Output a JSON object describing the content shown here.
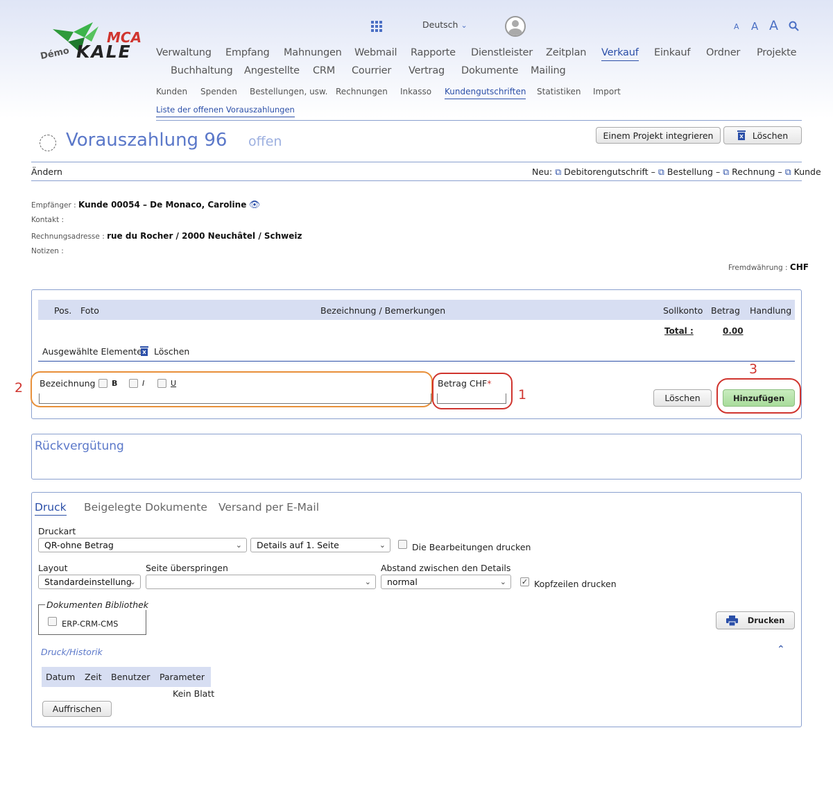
{
  "header": {
    "logo_top": "MCA",
    "logo_demo": "Démo",
    "logo_main": "KALE",
    "language": "Deutsch",
    "font_small": "A",
    "font_medium": "A",
    "font_large": "A"
  },
  "nav": {
    "main": [
      "Verwaltung",
      "Empfang",
      "Mahnungen",
      "Webmail",
      "Rapporte",
      "Dienstleister",
      "Zeitplan",
      "Verkauf",
      "Einkauf",
      "Ordner",
      "Projekte",
      "Buchhaltung",
      "Angestellte",
      "CRM",
      "Courrier",
      "Vertrag",
      "Dokumente",
      "Mailing"
    ],
    "sub": [
      "Kunden",
      "Spenden",
      "Bestellungen, usw.",
      "Rechnungen",
      "Inkasso",
      "Kundengutschriften",
      "Statistiken",
      "Import"
    ],
    "sub2": "Liste der offenen Vorauszahlungen"
  },
  "page": {
    "title": "Vorauszahlung 96",
    "status": "offen",
    "btn_integrate": "Einem Projekt integrieren",
    "btn_delete": "Löschen",
    "edit": "Ändern",
    "new_label": "Neu:",
    "new_links": [
      "Debitorengutschrift",
      "Bestellung",
      "Rechnung",
      "Kunde"
    ],
    "sep": "–"
  },
  "info": {
    "recipient_label": "Empfänger :",
    "recipient_value": "Kunde 00054 – De Monaco, Caroline",
    "contact_label": "Kontakt :",
    "address_label": "Rechnungsadresse :",
    "address_value": "rue du Rocher / 2000 Neuchâtel / Schweiz",
    "notes_label": "Notizen :",
    "currency_label": "Fremdwährung :",
    "currency_value": "CHF"
  },
  "table": {
    "headers": [
      "Pos.",
      "Foto",
      "Bezeichnung / Bemerkungen",
      "Sollkonto",
      "Betrag",
      "Handlung"
    ],
    "total_label": "Total :",
    "total_value": "0.00",
    "selected_label": "Ausgewählte Elemente:",
    "selected_delete": "Löschen"
  },
  "form": {
    "desc_label": "Bezeichnung",
    "bold": "B",
    "italic": "I",
    "underline": "U",
    "amount_label": "Betrag CHF",
    "required": "*",
    "btn_clear": "Löschen",
    "btn_add": "Hinzufügen",
    "annot": [
      "1",
      "2",
      "3"
    ]
  },
  "refund": {
    "title": "Rückvergütung"
  },
  "print": {
    "tabs": [
      "Druck",
      "Beigelegte Dokumente",
      "Versand per E-Mail"
    ],
    "type_label": "Druckart",
    "type_value": "QR-ohne Betrag",
    "details_value": "Details auf 1. Seite",
    "print_edits": "Die Bearbeitungen drucken",
    "layout_label": "Layout",
    "layout_value": "Standardeinstellung",
    "skip_label": "Seite überspringen",
    "skip_value": "",
    "spacing_label": "Abstand zwischen den Details",
    "spacing_value": "normal",
    "print_headers": "Kopfzeilen drucken",
    "library_legend": "Dokumenten Bibliothek",
    "library_item": "ERP-CRM-CMS",
    "btn_print": "Drucken",
    "history_title": "Druck/Historik",
    "history_headers": [
      "Datum",
      "Zeit",
      "Benutzer",
      "Parameter"
    ],
    "history_empty": "Kein Blatt",
    "btn_refresh": "Auffrischen"
  },
  "colors": {
    "accent": "#2b4fa8",
    "annotation": "#d0352f",
    "orange": "#e8903a",
    "green": "#b9e4b0"
  }
}
